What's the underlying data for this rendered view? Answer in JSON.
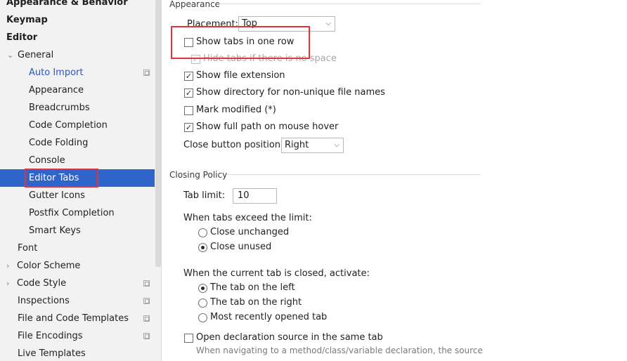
{
  "sidebar": {
    "items": [
      {
        "label": "Appearance & Behavior"
      },
      {
        "label": "Keymap"
      },
      {
        "label": "Editor"
      },
      {
        "label": "General"
      },
      {
        "label": "Auto Import"
      },
      {
        "label": "Appearance"
      },
      {
        "label": "Breadcrumbs"
      },
      {
        "label": "Code Completion"
      },
      {
        "label": "Code Folding"
      },
      {
        "label": "Console"
      },
      {
        "label": "Editor Tabs"
      },
      {
        "label": "Gutter Icons"
      },
      {
        "label": "Postfix Completion"
      },
      {
        "label": "Smart Keys"
      },
      {
        "label": "Font"
      },
      {
        "label": "Color Scheme"
      },
      {
        "label": "Code Style"
      },
      {
        "label": "Inspections"
      },
      {
        "label": "File and Code Templates"
      },
      {
        "label": "File Encodings"
      },
      {
        "label": "Live Templates"
      }
    ]
  },
  "appearance": {
    "title": "Appearance",
    "placement_label": "Placement:",
    "placement_value": "Top",
    "show_tabs_one_row": {
      "label": "Show tabs in one row",
      "checked": false
    },
    "hide_tabs_no_space": {
      "label": "Hide tabs if there is no space",
      "checked": true
    },
    "show_file_extension": {
      "label": "Show file extension",
      "checked": true
    },
    "show_directory": {
      "label": "Show directory for non-unique file names",
      "checked": true
    },
    "mark_modified": {
      "label": "Mark modified (*)",
      "checked": false
    },
    "show_full_path": {
      "label": "Show full path on mouse hover",
      "checked": true
    },
    "close_button_label": "Close button position:",
    "close_button_value": "Right"
  },
  "closing_policy": {
    "title": "Closing Policy",
    "tab_limit_label": "Tab limit:",
    "tab_limit_value": "10",
    "exceed_label": "When tabs exceed the limit:",
    "close_unchanged": "Close unchanged",
    "close_unused": "Close unused",
    "closed_label": "When the current tab is closed, activate:",
    "tab_on_left": "The tab on the left",
    "tab_on_right": "The tab on the right",
    "most_recent": "Most recently opened tab",
    "open_declaration": {
      "label": "Open declaration source in the same tab",
      "checked": false
    },
    "open_declaration_desc": "When navigating to a method/class/variable declaration, the source"
  },
  "icons": {
    "check": "✓",
    "expanded": "⌄",
    "collapsed": "›",
    "dropdown": "⌵"
  },
  "colors": {
    "selection": "#2f65ca",
    "link": "#2a55cc",
    "highlight_box": "#e53238"
  }
}
